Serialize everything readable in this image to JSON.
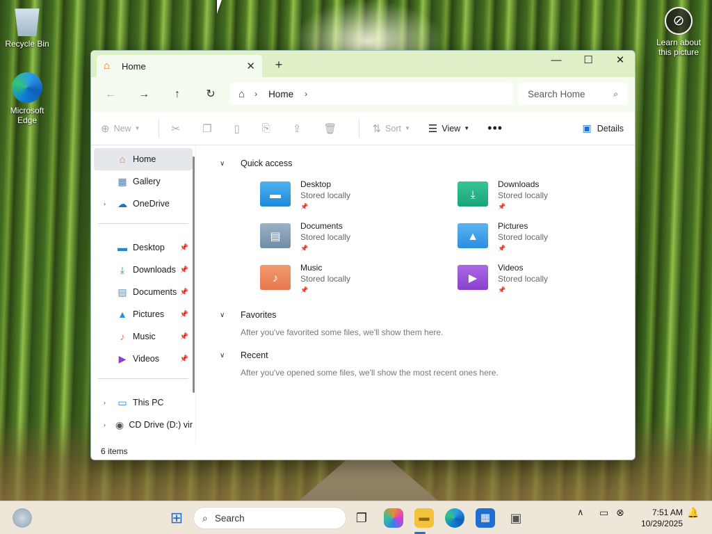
{
  "desktop": {
    "icons": [
      {
        "label": "Recycle Bin"
      },
      {
        "label": "Microsoft Edge"
      }
    ],
    "learn_label": "Learn about this picture"
  },
  "window": {
    "tab_title": "Home",
    "address": {
      "crumb": "Home"
    },
    "search_placeholder": "Search Home",
    "commands": {
      "new": "New",
      "sort": "Sort",
      "view": "View",
      "details": "Details"
    },
    "sidebar": {
      "top": [
        {
          "label": "Home"
        },
        {
          "label": "Gallery"
        },
        {
          "label": "OneDrive"
        }
      ],
      "pinned": [
        {
          "label": "Desktop"
        },
        {
          "label": "Downloads"
        },
        {
          "label": "Documents"
        },
        {
          "label": "Pictures"
        },
        {
          "label": "Music"
        },
        {
          "label": "Videos"
        }
      ],
      "drives": [
        {
          "label": "This PC"
        },
        {
          "label": "CD Drive (D:) vir"
        }
      ]
    },
    "content": {
      "quick_access_header": "Quick access",
      "quick_access": [
        {
          "name": "Desktop",
          "status": "Stored locally",
          "color": "#1e88d8"
        },
        {
          "name": "Downloads",
          "status": "Stored locally",
          "color": "#1aa37a"
        },
        {
          "name": "Documents",
          "status": "Stored locally",
          "color": "#6f8ea8"
        },
        {
          "name": "Pictures",
          "status": "Stored locally",
          "color": "#2a8ee0"
        },
        {
          "name": "Music",
          "status": "Stored locally",
          "color": "#e7784e"
        },
        {
          "name": "Videos",
          "status": "Stored locally",
          "color": "#8a3fd0"
        }
      ],
      "favorites_header": "Favorites",
      "favorites_empty": "After you've favorited some files, we'll show them here.",
      "recent_header": "Recent",
      "recent_empty": "After you've opened some files, we'll show the most recent ones here."
    },
    "status": "6 items"
  },
  "taskbar": {
    "search_label": "Search",
    "time": "7:51 AM",
    "date": "10/29/2025"
  }
}
